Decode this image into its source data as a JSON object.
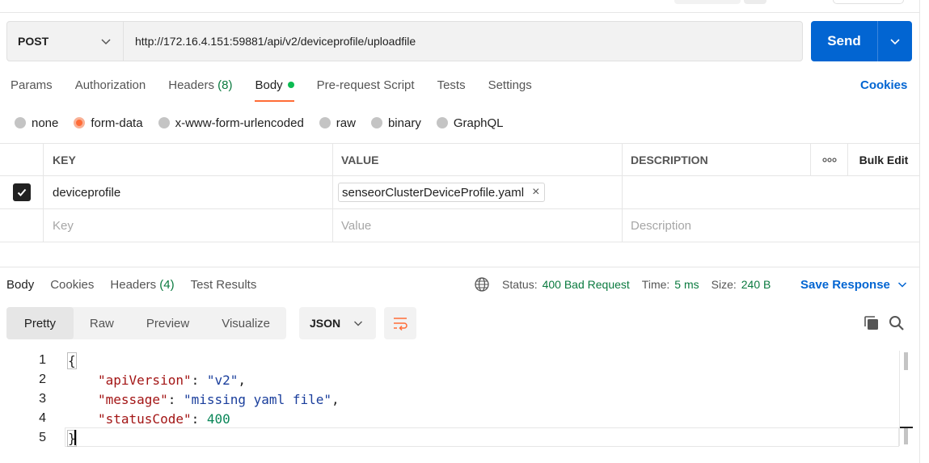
{
  "request": {
    "method": "POST",
    "url": "http://172.16.4.151:59881/api/v2/deviceprofile/uploadfile",
    "send_label": "Send"
  },
  "request_tabs": [
    {
      "label": "Params"
    },
    {
      "label": "Authorization"
    },
    {
      "label": "Headers",
      "count": "(8)"
    },
    {
      "label": "Body"
    },
    {
      "label": "Pre-request Script"
    },
    {
      "label": "Tests"
    },
    {
      "label": "Settings"
    }
  ],
  "cookies_label": "Cookies",
  "body_types": [
    "none",
    "form-data",
    "x-www-form-urlencoded",
    "raw",
    "binary",
    "GraphQL"
  ],
  "selected_body_type": "form-data",
  "kv_table": {
    "headers": {
      "key": "KEY",
      "value": "VALUE",
      "description": "DESCRIPTION",
      "bulk_edit": "Bulk Edit",
      "more": "ooo"
    },
    "rows": [
      {
        "key": "deviceprofile",
        "file": "senseorClusterDeviceProfile.yaml",
        "file_remove": "×",
        "checked": true
      }
    ],
    "placeholders": {
      "key": "Key",
      "value": "Value",
      "description": "Description"
    }
  },
  "response_tabs": [
    {
      "label": "Body"
    },
    {
      "label": "Cookies"
    },
    {
      "label": "Headers",
      "count": "(4)"
    },
    {
      "label": "Test Results"
    }
  ],
  "response_status": {
    "status_label": "Status:",
    "status_value": "400 Bad Request",
    "time_label": "Time:",
    "time_value": "5 ms",
    "size_label": "Size:",
    "size_value": "240 B"
  },
  "save_response_label": "Save Response",
  "view_modes": [
    "Pretty",
    "Raw",
    "Preview",
    "Visualize"
  ],
  "format": "JSON",
  "code_lines": [
    {
      "num": "1",
      "open": "{"
    },
    {
      "num": "2",
      "key": "\"apiVersion\"",
      "sep": ": ",
      "val": "\"v2\"",
      "tail": ","
    },
    {
      "num": "3",
      "key": "\"message\"",
      "sep": ": ",
      "val": "\"missing yaml file\"",
      "tail": ","
    },
    {
      "num": "4",
      "key": "\"statusCode\"",
      "sep": ": ",
      "val": "400",
      "tail": ""
    },
    {
      "num": "5",
      "close": "}"
    }
  ],
  "colors": {
    "accent": "#0265d2",
    "active_tab": "#ff6c37",
    "success": "#0a7a3f"
  },
  "icons": [
    "chevron-down-icon",
    "globe-icon",
    "wrap-lines-icon",
    "copy-icon",
    "search-icon",
    "checkbox-checked-icon",
    "close-icon"
  ]
}
